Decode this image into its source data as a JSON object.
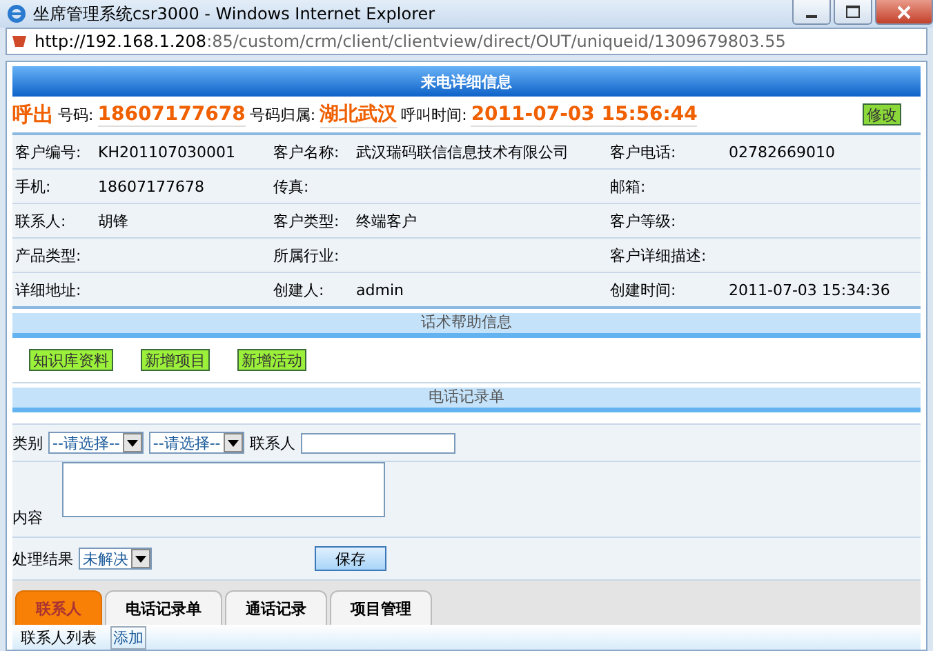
{
  "window": {
    "title": "坐席管理系统csr3000 - Windows Internet Explorer",
    "url_host": "http://192.168.1.208",
    "url_path": ":85/custom/crm/client/clientview/direct/OUT/uniqueid/1309679803.55"
  },
  "header": {
    "title": "来电详细信息"
  },
  "call": {
    "direction": "呼出",
    "number_label": "号码:",
    "number": "18607177678",
    "region_label": "号码归属:",
    "region": "湖北武汉",
    "time_label": "呼叫时间:",
    "time": "2011-07-03 15:56:44",
    "edit_button": "修改"
  },
  "info_rows": [
    [
      {
        "label": "客户编号:",
        "value": "KH201107030001"
      },
      {
        "label": "客户名称:",
        "value": "武汉瑞码联信信息技术有限公司"
      },
      {
        "label": "客户电话:",
        "value": "02782669010"
      }
    ],
    [
      {
        "label": "手机:",
        "value": "18607177678"
      },
      {
        "label": "传真:"
      },
      {
        "label": "邮箱:"
      }
    ],
    [
      {
        "label": "联系人:",
        "value": "胡锋"
      },
      {
        "label": "客户类型:",
        "value": "终端客户"
      },
      {
        "label": "客户等级:"
      }
    ],
    [
      {
        "label": "产品类型:"
      },
      {
        "label": "所属行业:"
      },
      {
        "label": "客户详细描述:"
      }
    ],
    [
      {
        "label": "详细地址:"
      },
      {
        "label": "创建人:",
        "value": "admin"
      },
      {
        "label": "创建时间:",
        "value": "2011-07-03 15:34:36"
      }
    ]
  ],
  "help_section": {
    "title": "话术帮助信息",
    "buttons": [
      "知识库资料",
      "新增项目",
      "新增活动"
    ]
  },
  "record_section": {
    "title": "电话记录单"
  },
  "form": {
    "category_label": "类别",
    "select_1": "--请选择--",
    "select_2": "--请选择--",
    "contact_label": "联系人",
    "content_label": "内容",
    "result_label": "处理结果",
    "result_value": "未解决",
    "save_button": "保存"
  },
  "tabs": [
    {
      "label": "联系人",
      "selected": true
    },
    {
      "label": "电话记录单",
      "selected": false
    },
    {
      "label": "通话记录",
      "selected": false
    },
    {
      "label": "项目管理",
      "selected": false
    }
  ],
  "contact_list": {
    "label": "联系人列表",
    "add_link": "添加"
  }
}
